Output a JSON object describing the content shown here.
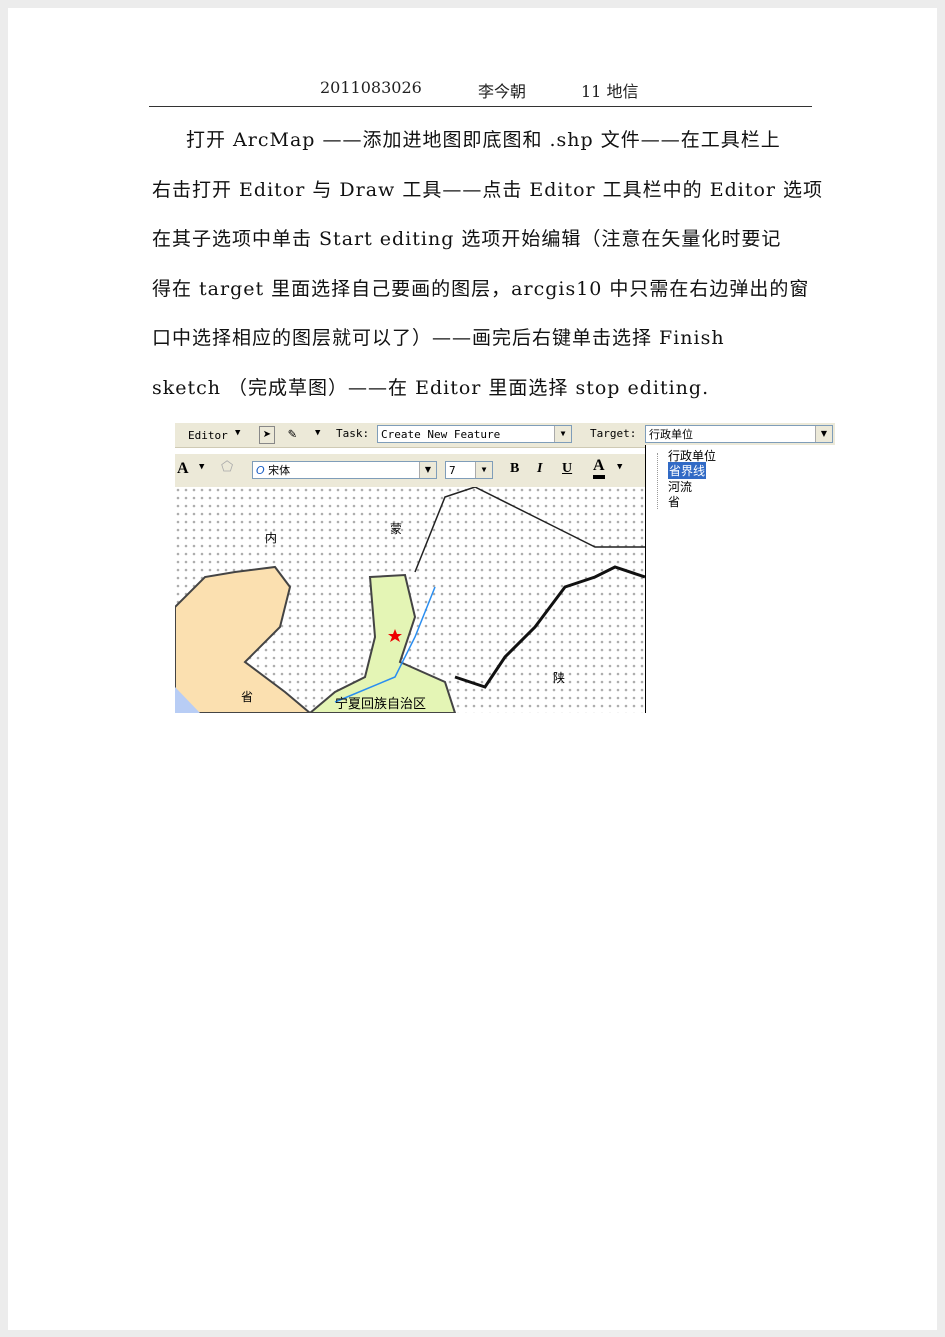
{
  "header": {
    "id": "2011083026",
    "name": "李今朝",
    "class": "11 地信"
  },
  "body_lines": [
    "打开 ArcMap ——添加进地图即底图和 .shp 文件——在工具栏上",
    "右击打开 Editor 与 Draw 工具——点击 Editor 工具栏中的 Editor 选项",
    "在其子选项中单击 Start editing 选项开始编辑（注意在矢量化时要记",
    "得在 target 里面选择自己要画的图层，arcgis10 中只需在右边弹出的窗",
    "口中选择相应的图层就可以了）——画完后右键单击选择 Finish",
    "sketch （完成草图）——在 Editor 里面选择 stop editing."
  ],
  "screenshot": {
    "editor_menu": "Editor",
    "task_label": "Task:",
    "task_value": "Create New Feature",
    "target_label": "Target:",
    "target_value": "行政单位",
    "font_value": "宋体",
    "size_value": "7",
    "bold": "B",
    "italic": "I",
    "underline": "U",
    "font_color": "A",
    "target_options": [
      "行政单位",
      "省界线",
      "河流",
      "省"
    ],
    "selected_option": "省界线",
    "map_labels": [
      "内",
      "蒙",
      "宁夏回族自治区",
      "陕",
      "省"
    ]
  }
}
